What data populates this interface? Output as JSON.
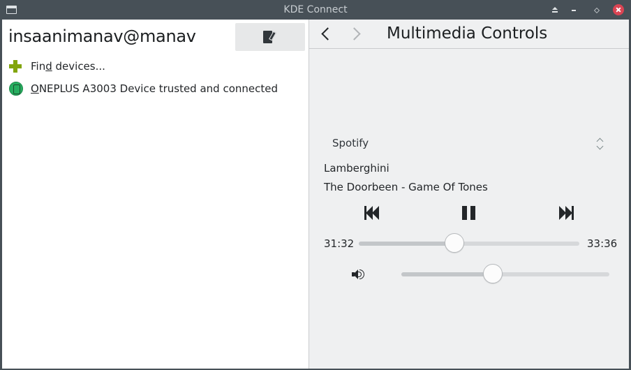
{
  "window": {
    "title": "KDE Connect"
  },
  "left": {
    "hostname": "insaanimanav@manav",
    "find_devices": {
      "before": "Fin",
      "mnemonic": "d",
      "after": " devices..."
    },
    "device": {
      "mnemonic": "O",
      "rest": "NEPLUS A3003 Device trusted and connected"
    }
  },
  "right": {
    "page_title": "Multimedia Controls",
    "player": "Spotify",
    "track_title": "Lamberghini",
    "track_artist": "The Doorbeen - Game Of Tones",
    "position_label": "31:32",
    "length_label": "33:36",
    "position_fraction": 0.435,
    "volume_fraction": 0.44
  },
  "icons": {
    "app": "window-icon",
    "keep_above": "keep-above-icon",
    "minimize": "minimize-icon",
    "maximize": "maximize-icon",
    "close": "close-icon",
    "rename": "edit-rename-icon",
    "find": "plus-icon",
    "device": "smartphone-icon",
    "back": "go-previous-icon",
    "forward": "go-next-icon",
    "previous": "media-skip-backward-icon",
    "pause": "media-playback-pause-icon",
    "next": "media-skip-forward-icon",
    "volume": "audio-volume-icon"
  },
  "colors": {
    "titlebar": "#475057",
    "close": "#da4453",
    "find_plus": "#82a50c",
    "device_status": "#27ae60"
  }
}
